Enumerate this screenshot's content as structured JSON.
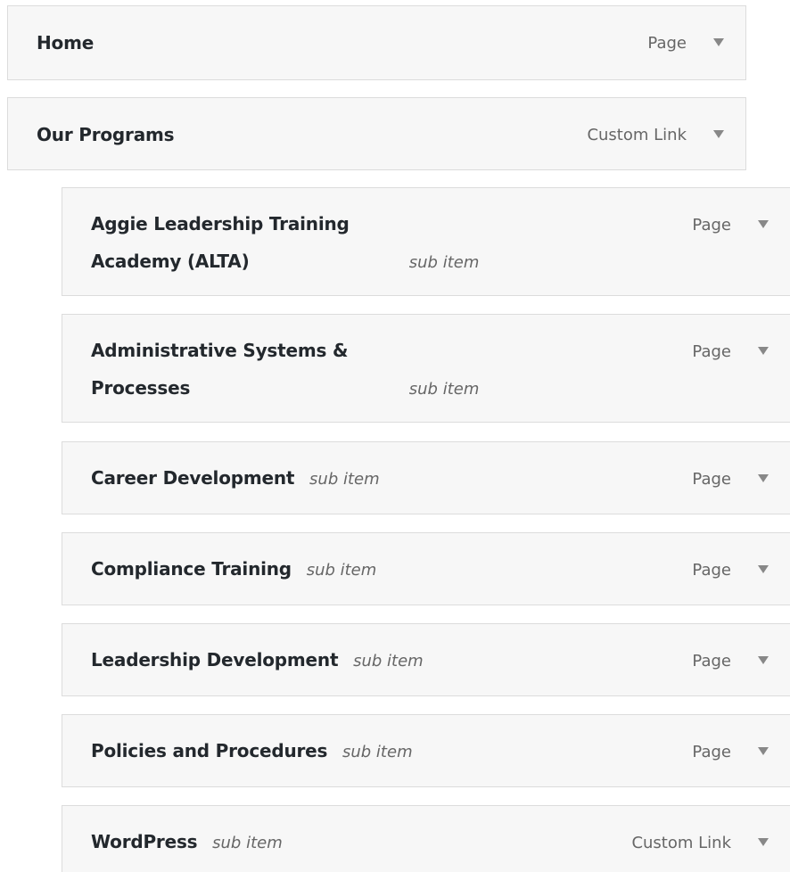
{
  "menu": {
    "items": [
      {
        "label": "Home",
        "sub_label": "",
        "type": "Page",
        "toggle_icon": "triangle-down-icon"
      },
      {
        "label": "Our Programs",
        "sub_label": "",
        "type": "Custom Link",
        "toggle_icon": "triangle-down-icon"
      },
      {
        "label": "Aggie Leadership Training Academy (ALTA)",
        "sub_label": "sub item",
        "type": "Page",
        "toggle_icon": "triangle-down-icon"
      },
      {
        "label": "Administrative Systems & Processes",
        "sub_label": "sub item",
        "type": "Page",
        "toggle_icon": "triangle-down-icon"
      },
      {
        "label": "Career Development",
        "sub_label": "sub item",
        "type": "Page",
        "toggle_icon": "triangle-down-icon"
      },
      {
        "label": "Compliance Training",
        "sub_label": "sub item",
        "type": "Page",
        "toggle_icon": "triangle-down-icon"
      },
      {
        "label": "Leadership Development",
        "sub_label": "sub item",
        "type": "Page",
        "toggle_icon": "triangle-down-icon"
      },
      {
        "label": "Policies and Procedures",
        "sub_label": "sub item",
        "type": "Page",
        "toggle_icon": "triangle-down-icon"
      },
      {
        "label": "WordPress",
        "sub_label": "sub item",
        "type": "Custom Link",
        "toggle_icon": "triangle-down-icon"
      }
    ]
  },
  "colors": {
    "item_background": "#f7f7f7",
    "item_border": "#dcdcdc",
    "title_text": "#23282d",
    "muted_text": "#666666",
    "toggle_arrow": "#888888"
  }
}
